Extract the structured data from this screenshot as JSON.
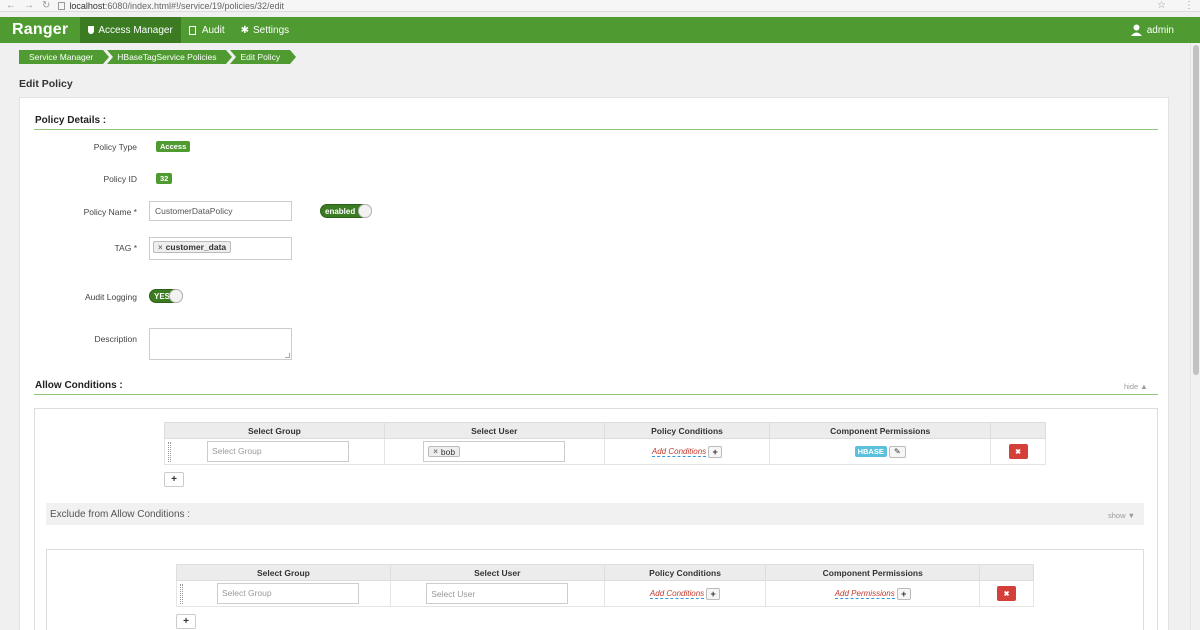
{
  "browser": {
    "url_host": "localhost",
    "url_path": ":6080/index.html#!/service/19/policies/32/edit"
  },
  "nav": {
    "brand": "Ranger",
    "access_manager": "Access Manager",
    "audit": "Audit",
    "settings": "Settings",
    "user": "admin"
  },
  "breadcrumb": [
    "Service Manager",
    "HBaseTagService Policies",
    "Edit Policy"
  ],
  "page_title": "Edit Policy",
  "policy_details": {
    "section_title": "Policy Details :",
    "policy_type_label": "Policy Type",
    "policy_type_value": "Access",
    "policy_id_label": "Policy ID",
    "policy_id_value": "32",
    "policy_name_label": "Policy Name *",
    "policy_name_value": "CustomerDataPolicy",
    "enabled_label": "enabled",
    "tag_label": "TAG *",
    "tag_value": "customer_data",
    "audit_logging_label": "Audit Logging",
    "audit_logging_value": "YES",
    "description_label": "Description"
  },
  "allow_conditions": {
    "section_title": "Allow Conditions :",
    "hide_label": "hide ▲",
    "columns": [
      "Select Group",
      "Select User",
      "Policy Conditions",
      "Component Permissions"
    ],
    "row": {
      "group_placeholder": "Select Group",
      "user_value": "bob",
      "add_conditions": "Add Conditions",
      "permission": "HBASE"
    }
  },
  "exclude_allow": {
    "title": "Exclude from Allow Conditions :",
    "show_label": "show ▼",
    "columns": [
      "Select Group",
      "Select User",
      "Policy Conditions",
      "Component Permissions"
    ],
    "row": {
      "group_placeholder": "Select Group",
      "user_placeholder": "Select User",
      "add_conditions": "Add Conditions",
      "add_permissions": "Add Permissions"
    }
  },
  "icons": {
    "back": "←",
    "forward": "→",
    "reload": "↻",
    "star": "☆",
    "menu": "⋮",
    "plus": "+",
    "delete": "✖",
    "edit": "✎",
    "remove": "×"
  },
  "colors": {
    "brand_green": "#4f9a31",
    "danger_red": "#d43f3a",
    "info_blue": "#5bc0de"
  }
}
